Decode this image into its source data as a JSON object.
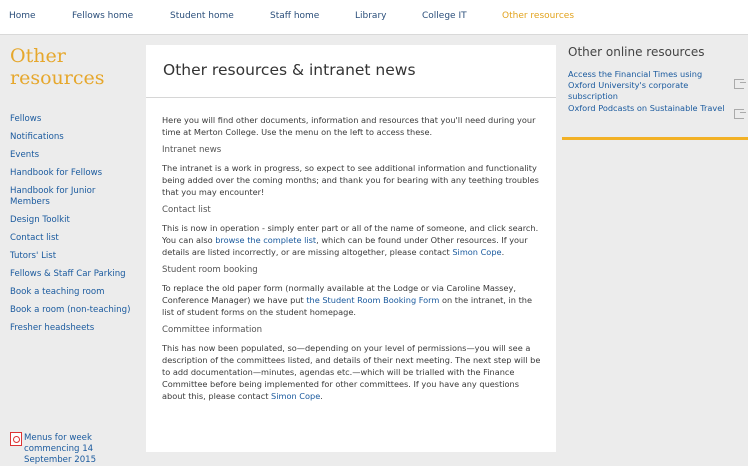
{
  "topnav": {
    "items": [
      "Home",
      "Fellows home",
      "Student home",
      "Staff home",
      "Library",
      "College IT",
      "Other resources"
    ]
  },
  "left": {
    "title": "Other resources",
    "nav": [
      "Fellows",
      "Notifications",
      "Events",
      "Handbook for Fellows",
      "Handbook for Junior Members",
      "Design Toolkit",
      "Contact list",
      "Tutors' List",
      "Fellows & Staff Car Parking",
      "Book a teaching room",
      "Book a room (non-teaching)",
      "Fresher headsheets"
    ],
    "pdf_label": "Menus for week commencing 14 September 2015"
  },
  "main": {
    "title": "Other resources & intranet news",
    "intro": "Here you will find other documents, information and resources that you'll need during your time at Merton College. Use the menu on the left to access these.",
    "intranet_heading": "Intranet news",
    "intranet_text": "The intranet is a work in progress, so expect to see additional information and functionality being added over the coming months; and thank you for bearing with any teething troubles that you may encounter!",
    "contact_heading": "Contact list",
    "contact_text_1": "This is now in operation - simply enter part or all of the name of someone, and click search. You can also ",
    "contact_link_1": "browse the complete list",
    "contact_text_2": ", which can be found under Other resources. If your details are listed incorrectly, or are missing altogether, please contact ",
    "contact_link_2": "Simon Cope",
    "contact_text_3": ".",
    "booking_heading": "Student room booking",
    "booking_text_1": "To replace the old paper form (normally available at the Lodge or via Caroline Massey, Conference Manager) we have put ",
    "booking_link": "the Student Room Booking Form",
    "booking_text_2": " on the intranet, in the list of student forms on the student homepage.",
    "committee_heading": "Committee information",
    "committee_text_1": "This has now been populated, so—depending on your level of permissions—you will see a description of the committees listed, and details of their next meeting. The next step will be to add documentation—minutes, agendas etc.—which will be trialled with the Finance Committee before being implemented for other committees. If you have any questions about this, please contact ",
    "committee_link": "Simon Cope",
    "committee_text_2": "."
  },
  "right": {
    "title": "Other online resources",
    "items": [
      "Access the Financial Times using Oxford University's corporate subscription",
      "Oxford Podcasts on Sustainable Travel"
    ]
  },
  "colors": {
    "accent": "#e6a72c",
    "link": "#1a5a9e",
    "nav_text": "#2a4e7a",
    "bar": "#f2b126"
  }
}
